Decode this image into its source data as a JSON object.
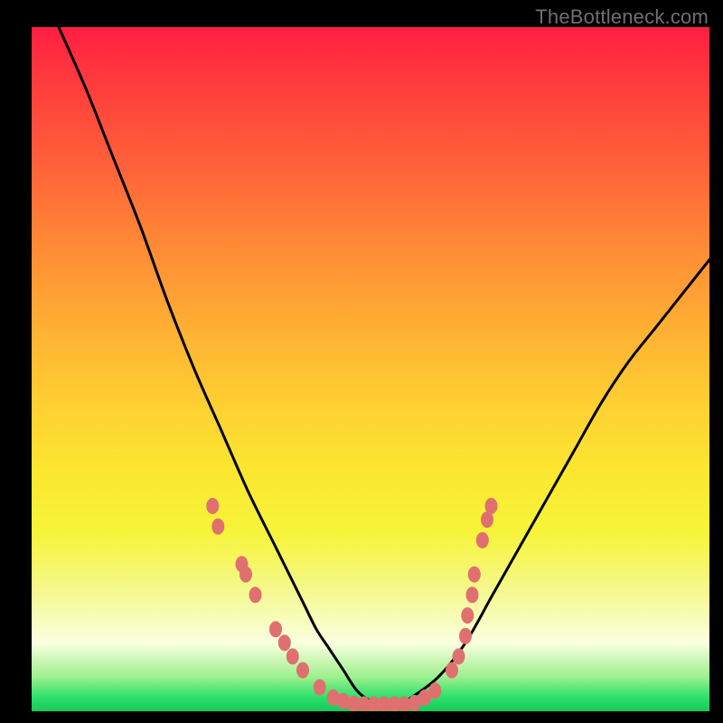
{
  "watermark": "TheBottleneck.com",
  "colors": {
    "page_bg": "#000000",
    "curve": "#000000",
    "marker_fill": "#e07070",
    "marker_stroke": "#e07070"
  },
  "chart_data": {
    "type": "line",
    "title": "",
    "xlabel": "",
    "ylabel": "",
    "xlim": [
      0,
      100
    ],
    "ylim": [
      0,
      100
    ],
    "grid": false,
    "legend": false,
    "series": [
      {
        "name": "bottleneck-curve",
        "x": [
          0,
          4,
          8,
          12,
          16,
          20,
          24,
          28,
          32,
          36,
          40,
          42,
          44,
          46,
          48,
          50,
          52,
          54,
          56,
          60,
          64,
          68,
          72,
          76,
          80,
          84,
          88,
          92,
          96,
          100
        ],
        "y": [
          null,
          100,
          91,
          81,
          71,
          60,
          50,
          41,
          32,
          24,
          16,
          12,
          9,
          6,
          3,
          1.5,
          1,
          1,
          2,
          5,
          10,
          17,
          24,
          31,
          38,
          45,
          51,
          56,
          61,
          66
        ]
      }
    ],
    "markers": [
      {
        "x": 26.7,
        "y": 30.0
      },
      {
        "x": 27.5,
        "y": 27.0
      },
      {
        "x": 31.0,
        "y": 21.5
      },
      {
        "x": 31.6,
        "y": 20.0
      },
      {
        "x": 33.0,
        "y": 17.0
      },
      {
        "x": 36.0,
        "y": 12.0
      },
      {
        "x": 37.3,
        "y": 10.0
      },
      {
        "x": 38.5,
        "y": 8.0
      },
      {
        "x": 40.0,
        "y": 6.0
      },
      {
        "x": 42.5,
        "y": 3.5
      },
      {
        "x": 44.5,
        "y": 2.0
      },
      {
        "x": 46.0,
        "y": 1.5
      },
      {
        "x": 47.5,
        "y": 1.1
      },
      {
        "x": 49.0,
        "y": 1.0
      },
      {
        "x": 50.5,
        "y": 1.0
      },
      {
        "x": 52.0,
        "y": 1.0
      },
      {
        "x": 53.5,
        "y": 1.0
      },
      {
        "x": 55.0,
        "y": 1.0
      },
      {
        "x": 56.5,
        "y": 1.2
      },
      {
        "x": 58.0,
        "y": 2.0
      },
      {
        "x": 59.5,
        "y": 3.0
      },
      {
        "x": 62.0,
        "y": 6.0
      },
      {
        "x": 63.0,
        "y": 8.0
      },
      {
        "x": 64.0,
        "y": 11.0
      },
      {
        "x": 64.3,
        "y": 14.0
      },
      {
        "x": 65.0,
        "y": 17.0
      },
      {
        "x": 65.3,
        "y": 20.0
      },
      {
        "x": 66.5,
        "y": 25.0
      },
      {
        "x": 67.2,
        "y": 28.0
      },
      {
        "x": 67.8,
        "y": 30.0
      }
    ]
  }
}
